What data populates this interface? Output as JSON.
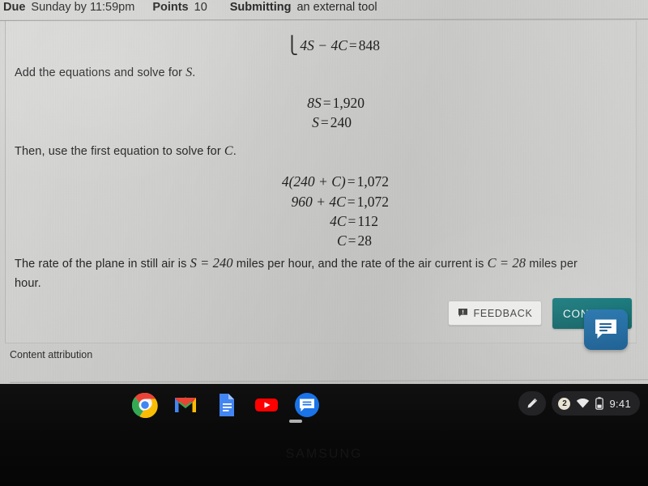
{
  "assignment_header": {
    "due_label": "Due",
    "due_value": "Sunday by 11:59pm",
    "points_label": "Points",
    "points_value": "10",
    "submitting_label": "Submitting",
    "submitting_value": "an external tool"
  },
  "content": {
    "equation_top": {
      "brace": "⎩",
      "lhs": "4S − 4C",
      "eq": "=",
      "rhs": "848"
    },
    "instruction_1": "Add the equations and solve for S.",
    "instruction_1_plain": "Add the equations and solve for ",
    "instruction_1_var": "S",
    "instruction_1_end": ".",
    "solve_s": [
      {
        "lhs": "8S",
        "eq": "=",
        "rhs": "1,920"
      },
      {
        "lhs": "S",
        "eq": "=",
        "rhs": "240"
      }
    ],
    "instruction_2_plain": "Then, use the first equation to solve for ",
    "instruction_2_var": "C",
    "instruction_2_end": ".",
    "solve_c": [
      {
        "lhs": "4(240 + C)",
        "eq": "=",
        "rhs": "1,072"
      },
      {
        "lhs": "960 + 4C",
        "eq": "=",
        "rhs": "1,072"
      },
      {
        "lhs": "4C",
        "eq": "=",
        "rhs": "112"
      },
      {
        "lhs": "C",
        "eq": "=",
        "rhs": "28"
      }
    ],
    "conclusion": {
      "part1": "The rate of the plane in still air is ",
      "math1": "S = 240",
      "part2": " miles per hour, and the rate of the air current is ",
      "math2": "C = 28",
      "part3": " miles per",
      "part4": "hour."
    },
    "attribution": "Content attribution"
  },
  "actions": {
    "feedback_label": "FEEDBACK",
    "continue_label": "CON",
    "continue_full_label": "CONTINUE"
  },
  "shelf": {
    "apps": [
      {
        "name": "chrome",
        "label": "Chrome"
      },
      {
        "name": "gmail",
        "label": "Gmail"
      },
      {
        "name": "docs",
        "label": "Docs"
      },
      {
        "name": "youtube",
        "label": "YouTube"
      },
      {
        "name": "messages",
        "label": "Messages"
      }
    ],
    "tray": {
      "notification_count": "2",
      "clock": "9:41"
    }
  },
  "device": {
    "brand": "SAMSUNG"
  },
  "colors": {
    "continue_teal": "#0e6265",
    "chat_blue": "#1a5e92",
    "chrome_blue": "#1a73e8",
    "gmail_red": "#ea4335",
    "docs_blue": "#4285f4",
    "youtube_red": "#ff0000",
    "messages_blue": "#1a73e8",
    "page_bg": "#cfcfcd",
    "text": "#262626"
  }
}
